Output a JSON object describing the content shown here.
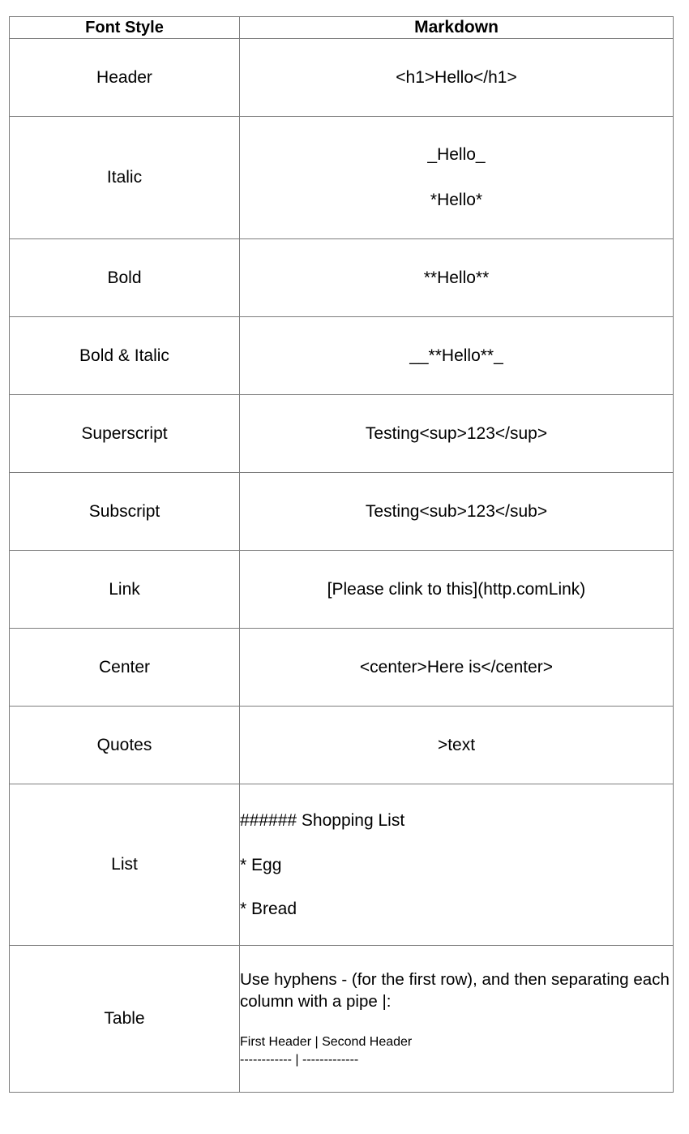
{
  "table": {
    "headers": {
      "col1": "Font Style",
      "col2": "Markdown"
    },
    "rows": [
      {
        "style": "Header",
        "markdown": "<h1>Hello</h1>"
      },
      {
        "style": "Italic",
        "markdown_line1": "_Hello_",
        "markdown_line2": "*Hello*"
      },
      {
        "style": "Bold",
        "markdown": "**Hello**"
      },
      {
        "style": "Bold & Italic",
        "markdown": "__**Hello**_"
      },
      {
        "style": "Superscript",
        "markdown": "Testing<sup>123</sup>"
      },
      {
        "style": "Subscript",
        "markdown": "Testing<sub>123</sub>"
      },
      {
        "style": "Link",
        "markdown": "[Please clink to this](http.comLink)"
      },
      {
        "style": "Center",
        "markdown": "<center>Here is</center>"
      },
      {
        "style": "Quotes",
        "markdown": ">text"
      },
      {
        "style": "List",
        "markdown_line1": "###### Shopping List",
        "markdown_line2": "* Egg",
        "markdown_line3": "* Bread"
      },
      {
        "style": "Table",
        "markdown_paragraph": "Use hyphens - (for the first row), and then separating each column with a pipe |:",
        "markdown_header_row": "First Header | Second Header",
        "markdown_separator_row": "------------ | -------------"
      }
    ]
  },
  "colors": {
    "border": "#7d7d7d",
    "text": "#000000",
    "background": "#ffffff"
  }
}
